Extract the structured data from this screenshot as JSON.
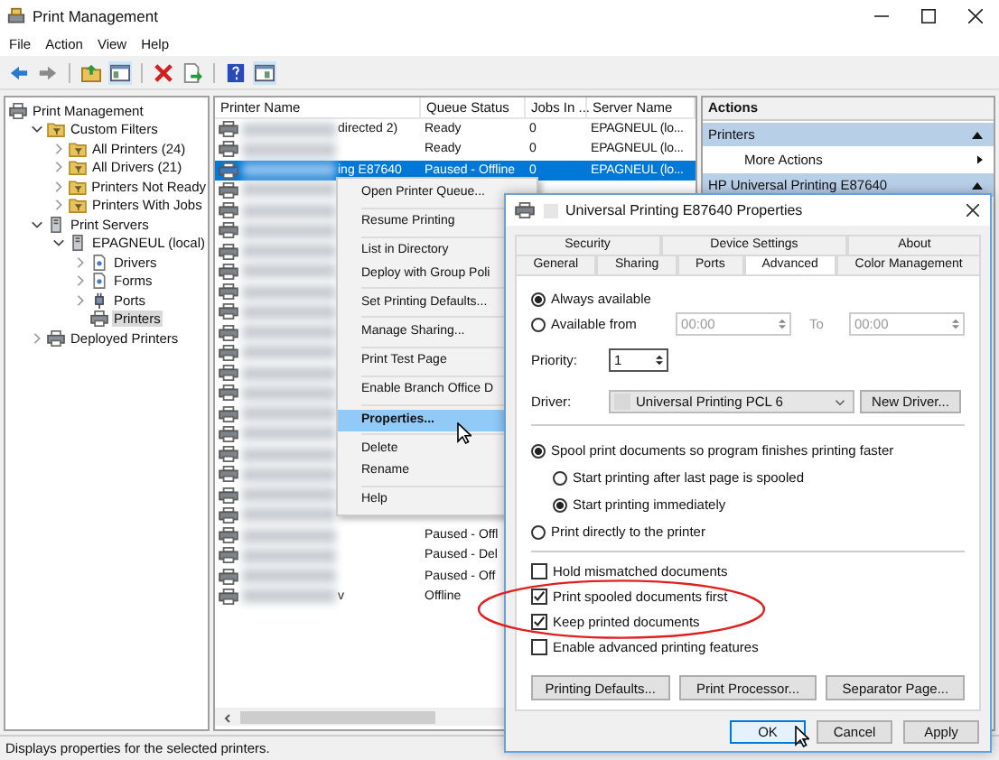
{
  "window": {
    "title": "Print Management"
  },
  "menu_bar": [
    "File",
    "Action",
    "View",
    "Help"
  ],
  "tree": [
    {
      "label": "Print Management",
      "kind": "printer",
      "selected": false,
      "children": [
        {
          "label": "Custom Filters",
          "kind": "folder",
          "selected": false,
          "expanded": true,
          "children": [
            {
              "label": "All Printers (24)",
              "kind": "folder",
              "selected": false,
              "expanded": false
            },
            {
              "label": "All Drivers (21)",
              "kind": "folder",
              "selected": false,
              "expanded": false
            },
            {
              "label": "Printers Not Ready",
              "kind": "folder",
              "selected": false,
              "expanded": false
            },
            {
              "label": "Printers With Jobs",
              "kind": "folder",
              "selected": false,
              "expanded": false
            }
          ]
        },
        {
          "label": "Print Servers",
          "kind": "server",
          "selected": false,
          "expanded": true,
          "children": [
            {
              "label": "EPAGNEUL (local)",
              "kind": "server",
              "selected": false,
              "expanded": true,
              "children": [
                {
                  "label": "Drivers",
                  "kind": "page",
                  "selected": false,
                  "expanded": false
                },
                {
                  "label": "Forms",
                  "kind": "page",
                  "selected": false,
                  "expanded": false
                },
                {
                  "label": "Ports",
                  "kind": "plug",
                  "selected": false,
                  "expanded": false
                },
                {
                  "label": "Printers",
                  "kind": "printer",
                  "selected": true
                }
              ]
            }
          ]
        },
        {
          "label": "Deployed Printers",
          "kind": "printer",
          "selected": false,
          "expanded": false
        }
      ]
    }
  ],
  "list": {
    "columns": [
      "Printer Name",
      "Queue Status",
      "Jobs In ...",
      "Server Name"
    ],
    "rows": [
      {
        "selected": false,
        "name": "directed 2)",
        "status": "Ready",
        "jobs": "0",
        "server": "EPAGNEUL (lo..."
      },
      {
        "selected": false,
        "status": "Ready",
        "jobs": "0",
        "server": "EPAGNEUL (lo..."
      },
      {
        "selected": true,
        "name": "ing E87640",
        "status": "Paused - Offline",
        "jobs": "0",
        "server": "EPAGNEUL (lo..."
      },
      {
        "selected": false
      },
      {
        "selected": false
      },
      {
        "selected": false
      },
      {
        "selected": false
      },
      {
        "selected": false
      },
      {
        "selected": false
      },
      {
        "selected": false
      },
      {
        "selected": false
      },
      {
        "selected": false
      },
      {
        "selected": false
      },
      {
        "selected": false
      },
      {
        "selected": false
      },
      {
        "selected": false
      },
      {
        "selected": false
      },
      {
        "selected": false
      },
      {
        "selected": false
      },
      {
        "selected": false
      },
      {
        "selected": false,
        "status": "Paused - Offl"
      },
      {
        "selected": false,
        "status": "Paused - Del"
      },
      {
        "selected": false,
        "status": "Paused - Off"
      },
      {
        "selected": false,
        "name": "v",
        "status": "Offline"
      }
    ]
  },
  "actions": {
    "title": "Actions",
    "sections": [
      {
        "label": "Printers",
        "items": [
          "More Actions"
        ]
      },
      {
        "label": "HP Universal Printing E87640"
      }
    ]
  },
  "context_menu": {
    "groups": [
      [
        {
          "label": "Open Printer Queue...",
          "selected": false
        }
      ],
      [
        {
          "label": "Resume Printing",
          "selected": false
        }
      ],
      [
        {
          "label": "List in Directory",
          "selected": false
        },
        {
          "label": "Deploy with Group Poli",
          "selected": false
        }
      ],
      [
        {
          "label": "Set Printing Defaults...",
          "selected": false
        }
      ],
      [
        {
          "label": "Manage Sharing...",
          "selected": false
        }
      ],
      [
        {
          "label": "Print Test Page",
          "selected": false
        }
      ],
      [
        {
          "label": "Enable Branch Office D",
          "selected": false
        }
      ],
      [
        {
          "label": "Properties...",
          "selected": true
        }
      ],
      [
        {
          "label": "Delete",
          "selected": false
        },
        {
          "label": "Rename",
          "selected": false
        }
      ],
      [
        {
          "label": "Help",
          "selected": false
        }
      ]
    ]
  },
  "dialog": {
    "title": "Universal Printing E87640 Properties",
    "tab_rows": [
      [
        {
          "label": "Security",
          "selected": false
        },
        {
          "label": "Device Settings",
          "selected": false
        },
        {
          "label": "About",
          "selected": false
        }
      ],
      [
        {
          "label": "General",
          "selected": false
        },
        {
          "label": "Sharing",
          "selected": false
        },
        {
          "label": "Ports",
          "selected": false
        },
        {
          "label": "Advanced",
          "selected": true
        },
        {
          "label": "Color Management",
          "selected": false
        }
      ]
    ],
    "availability": [
      {
        "label": "Always available",
        "selected": true
      },
      {
        "label": "Available from",
        "selected": false
      }
    ],
    "from_time": {
      "value": "00:00",
      "disabled": true
    },
    "to_label": "To",
    "to_time": {
      "value": "00:00",
      "disabled": true
    },
    "priority_label": "Priority:",
    "priority": "1",
    "driver_label": "Driver:",
    "driver": "Universal Printing PCL 6",
    "new_driver_button": "New Driver...",
    "spool_options": [
      {
        "label": "Spool print documents so program finishes printing faster",
        "selected": true,
        "children": [
          {
            "label": "Start printing after last page is spooled",
            "selected": false
          },
          {
            "label": "Start printing immediately",
            "selected": true
          }
        ]
      },
      {
        "label": "Print directly to the printer",
        "selected": false
      }
    ],
    "checkboxes": [
      {
        "label": "Hold mismatched documents",
        "checked": false
      },
      {
        "label": "Print spooled documents first",
        "checked": true
      },
      {
        "label": "Keep printed documents",
        "checked": true
      },
      {
        "label": "Enable advanced printing features",
        "checked": false
      }
    ],
    "buttons": [
      "Printing Defaults...",
      "Print Processor...",
      "Separator Page..."
    ],
    "footer_buttons": [
      "OK",
      "Cancel",
      "Apply"
    ]
  },
  "status_bar": "Displays properties for the selected printers."
}
